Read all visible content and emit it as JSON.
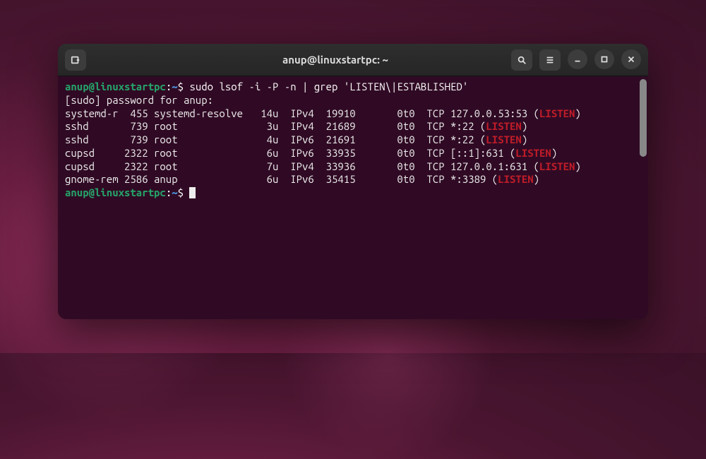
{
  "window": {
    "title": "anup@linuxstartpc: ~"
  },
  "prompt": {
    "user_host": "anup@linuxstartpc",
    "colon": ":",
    "path": "~",
    "dollar": "$",
    "command": "sudo lsof -i -P -n | grep 'LISTEN\\|ESTABLISHED'",
    "sudo_line": "[sudo] password for anup:"
  },
  "listen_word": "LISTEN",
  "rows": [
    {
      "cmd": "systemd-r",
      "pid": "455",
      "user": "systemd-resolve",
      "fd": "14u",
      "type": "IPv4",
      "dev": "19910",
      "size": "0t0",
      "node": "TCP",
      "name_pre": "127.0.0.53:53 (",
      "name_post": ")"
    },
    {
      "cmd": "sshd",
      "pid": "739",
      "user": "root",
      "fd": "3u",
      "type": "IPv4",
      "dev": "21689",
      "size": "0t0",
      "node": "TCP",
      "name_pre": "*:22 (",
      "name_post": ")"
    },
    {
      "cmd": "sshd",
      "pid": "739",
      "user": "root",
      "fd": "4u",
      "type": "IPv6",
      "dev": "21691",
      "size": "0t0",
      "node": "TCP",
      "name_pre": "*:22 (",
      "name_post": ")"
    },
    {
      "cmd": "cupsd",
      "pid": "2322",
      "user": "root",
      "fd": "6u",
      "type": "IPv6",
      "dev": "33935",
      "size": "0t0",
      "node": "TCP",
      "name_pre": "[::1]:631 (",
      "name_post": ")"
    },
    {
      "cmd": "cupsd",
      "pid": "2322",
      "user": "root",
      "fd": "7u",
      "type": "IPv4",
      "dev": "33936",
      "size": "0t0",
      "node": "TCP",
      "name_pre": "127.0.0.1:631 (",
      "name_post": ")"
    },
    {
      "cmd": "gnome-rem",
      "pid": "2586",
      "user": "anup",
      "fd": "6u",
      "type": "IPv6",
      "dev": "35415",
      "size": "0t0",
      "node": "TCP",
      "name_pre": "*:3389 (",
      "name_post": ")"
    }
  ]
}
